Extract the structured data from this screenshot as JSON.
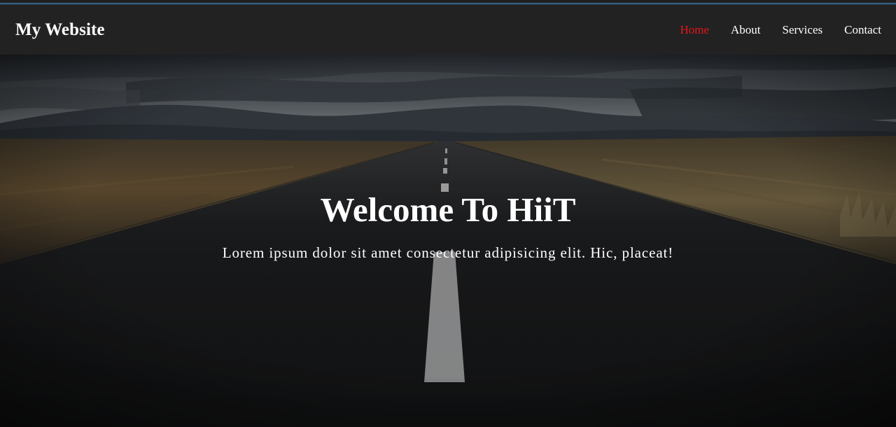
{
  "site": {
    "brand": "My Website"
  },
  "nav": {
    "items": [
      {
        "label": "Home",
        "active": true
      },
      {
        "label": "About",
        "active": false
      },
      {
        "label": "Services",
        "active": false
      },
      {
        "label": "Contact",
        "active": false
      }
    ]
  },
  "hero": {
    "title": "Welcome To HiiT",
    "subtitle": "Lorem ipsum dolor sit amet consectetur adipisicing elit. Hic, placeat!"
  },
  "colors": {
    "navbar_bg": "#222222",
    "active_link": "#e8141b",
    "text": "#ffffff"
  }
}
